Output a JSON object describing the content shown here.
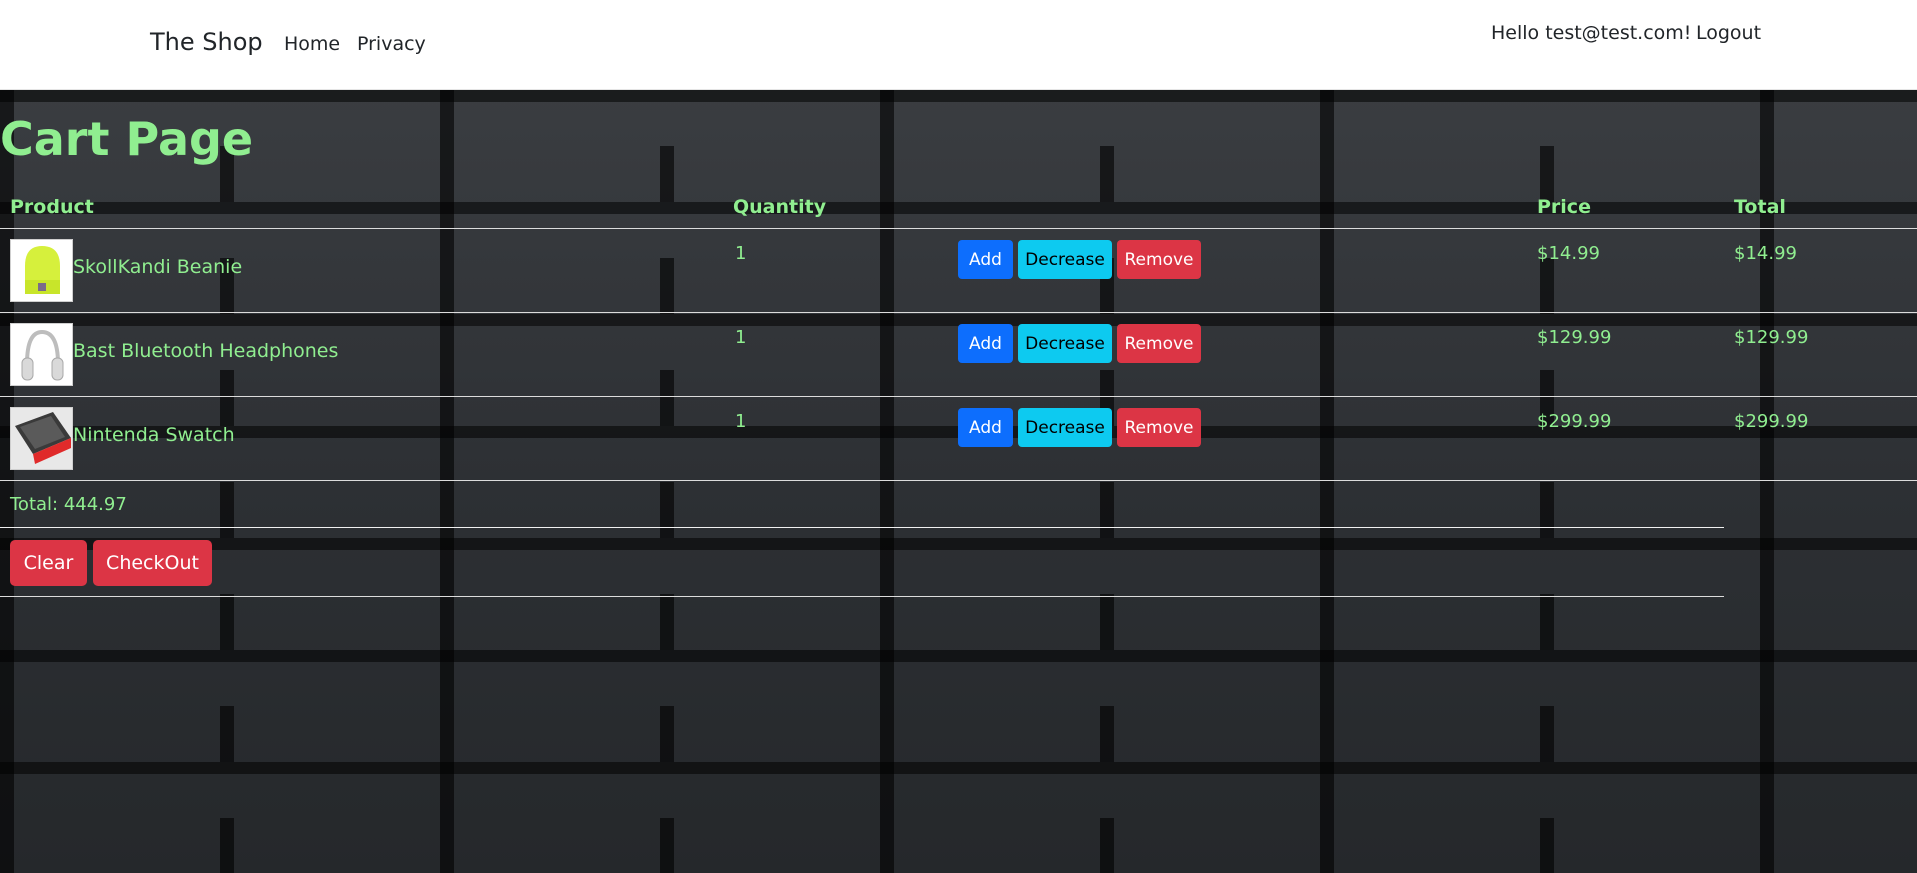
{
  "nav": {
    "brand": "The Shop",
    "links": [
      "Home",
      "Privacy"
    ],
    "greeting": "Hello test@test.com!",
    "logout": "Logout"
  },
  "page": {
    "title": "Cart Page"
  },
  "table": {
    "headers": {
      "product": "Product",
      "quantity": "Quantity",
      "price": "Price",
      "total": "Total"
    },
    "buttons": {
      "add": "Add",
      "decrease": "Decrease",
      "remove": "Remove"
    },
    "rows": [
      {
        "name": "SkollKandi Beanie",
        "quantity": "1",
        "price": "$14.99",
        "total": "$14.99",
        "thumb_icon": "beanie-thumbnail"
      },
      {
        "name": "Bast Bluetooth Headphones",
        "quantity": "1",
        "price": "$129.99",
        "total": "$129.99",
        "thumb_icon": "headphones-thumbnail"
      },
      {
        "name": "Nintenda Swatch",
        "quantity": "1",
        "price": "$299.99",
        "total": "$299.99",
        "thumb_icon": "console-thumbnail"
      }
    ]
  },
  "summary": {
    "total_text": "Total: 444.97",
    "clear": "Clear",
    "checkout": "CheckOut"
  },
  "colors": {
    "text_accent": "#90ee90",
    "add_button": "#0d6efd",
    "decrease_button": "#0dcaf0",
    "remove_button": "#dc3545"
  }
}
